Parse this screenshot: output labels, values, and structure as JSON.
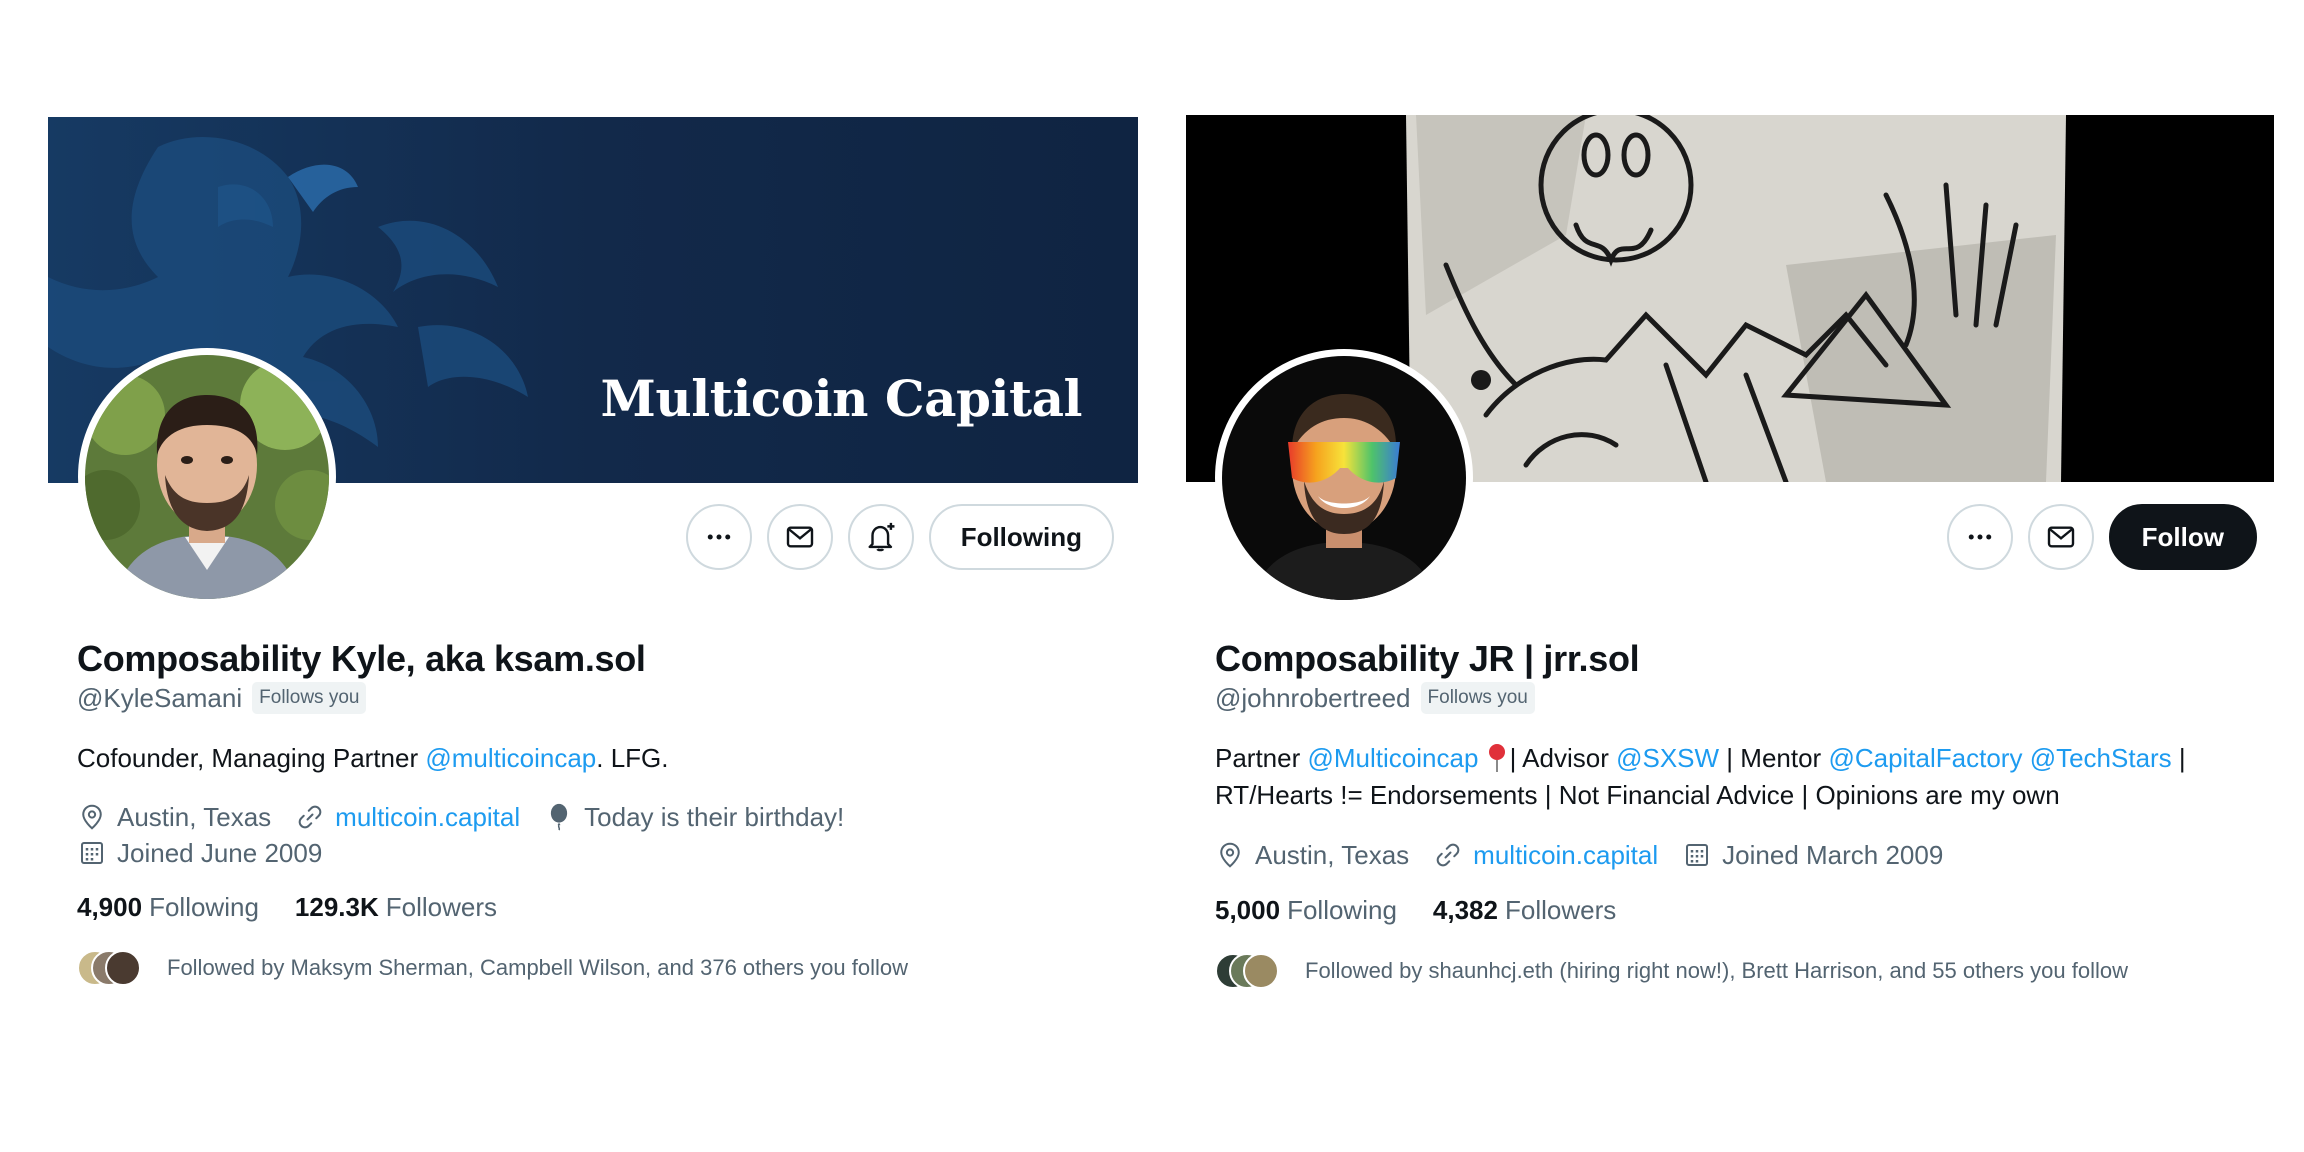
{
  "profiles": [
    {
      "banner_text": "Multicoin Capital",
      "name": "Composability Kyle, aka ksam.sol",
      "handle": "@KyleSamani",
      "follows_you": "Follows you",
      "follow_button": "Following",
      "bio": {
        "t1": "Cofounder, Managing Partner ",
        "link1": "@multicoincap",
        "t2": ". LFG."
      },
      "location": "Austin, Texas",
      "website": "multicoin.capital",
      "birthday": "Today is their birthday!",
      "joined": "Joined June 2009",
      "following_count": "4,900",
      "following_label": "Following",
      "followers_count": "129.3K",
      "followers_label": "Followers",
      "followed_by": "Followed by Maksym Sherman, Campbell Wilson, and 376 others you follow"
    },
    {
      "name": "Composability JR | jrr.sol",
      "handle": "@johnrobertreed",
      "follows_you": "Follows you",
      "follow_button": "Follow",
      "bio": {
        "t1": "Partner ",
        "link1": "@Multicoincap",
        "t2": " ",
        "t3": "| Advisor ",
        "link2": "@SXSW",
        "t4": " | Mentor ",
        "link3": "@CapitalFactory",
        "t5": " ",
        "link4": "@TechStars",
        "t6": " |",
        "line2": "RT/Hearts != Endorsements | Not Financial Advice | Opinions are my own"
      },
      "location": "Austin, Texas",
      "website": "multicoin.capital",
      "joined": "Joined March 2009",
      "following_count": "5,000",
      "following_label": "Following",
      "followers_count": "4,382",
      "followers_label": "Followers",
      "followed_by": "Followed by shaunhcj.eth (hiring right now!), Brett Harrison, and 55 others you follow"
    }
  ],
  "icons": {
    "more": "more-icon",
    "message": "envelope-icon",
    "notify": "bell-plus-icon",
    "location": "location-pin-icon",
    "link": "link-icon",
    "birthday": "balloon-icon",
    "calendar": "calendar-icon"
  },
  "colors": {
    "link": "#1d9bf0",
    "secondary_text": "#536471",
    "banner_navy": "#12294a",
    "dark_button": "#0f1419"
  }
}
